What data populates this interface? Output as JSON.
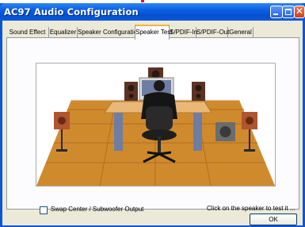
{
  "window": {
    "title": "AC97 Audio Configuration"
  },
  "tabs": [
    {
      "label": "Sound Effect"
    },
    {
      "label": "Equalizer"
    },
    {
      "label": "Speaker Configuration"
    },
    {
      "label": "Speaker Test",
      "active": true
    },
    {
      "label": "S/PDIF-In"
    },
    {
      "label": "S/PDIF-Out"
    },
    {
      "label": "General"
    }
  ],
  "speaker_test": {
    "swap_checkbox": {
      "label": "Swap Center / Subwoofer Output",
      "checked": false
    },
    "hint": "Click on the speaker to test it ..."
  },
  "buttons": {
    "ok": "OK"
  },
  "colors": {
    "titlebar": "#0a5fe0",
    "floor": "#d08a2e",
    "active_tab_highlight": "#f7b33b"
  },
  "icons": [
    "minimize-icon",
    "maximize-icon",
    "close-icon"
  ]
}
